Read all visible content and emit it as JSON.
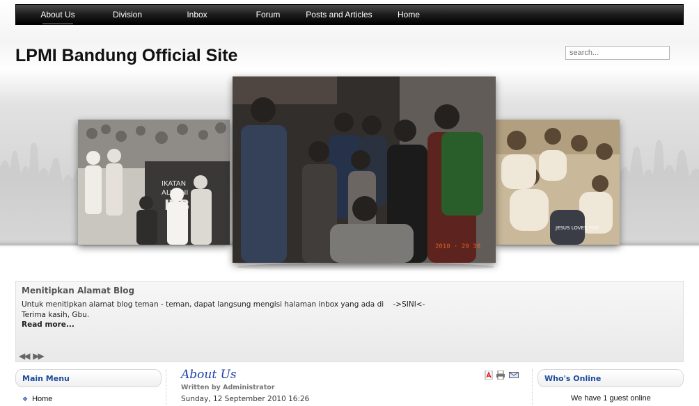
{
  "nav": {
    "items": [
      {
        "label": "About Us",
        "active": true
      },
      {
        "label": "Division"
      },
      {
        "label": "Inbox"
      },
      {
        "label": "Forum"
      },
      {
        "label": "Posts and Articles"
      },
      {
        "label": "Home"
      }
    ]
  },
  "header": {
    "site_title": "LPMI Bandung Official Site",
    "search_placeholder": "search..."
  },
  "gallery": {
    "center_photo_date": "2010 · 29 30"
  },
  "news": {
    "title": "Menitipkan Alamat Blog",
    "line1": "Untuk menitipkan alamat blog teman - teman, dapat langsung mengisi halaman inbox yang ada di    ->SINI<-",
    "line2": "Terima kasih, Gbu.",
    "read_more": "Read more..."
  },
  "left_module": {
    "title": "Main Menu",
    "items": [
      {
        "label": "Home"
      }
    ]
  },
  "article": {
    "title": "About Us",
    "author": "Written by Administrator",
    "date": "Sunday, 12 September 2010 16:26",
    "tools": [
      "pdf-icon",
      "print-icon",
      "email-icon"
    ]
  },
  "right_module": {
    "title": "Who's Online",
    "text": "We have 1 guest online"
  },
  "colors": {
    "nav_bg": "#1c1c1c",
    "link_blue": "#1c4b9c",
    "title_blue": "#1a3ea8"
  }
}
